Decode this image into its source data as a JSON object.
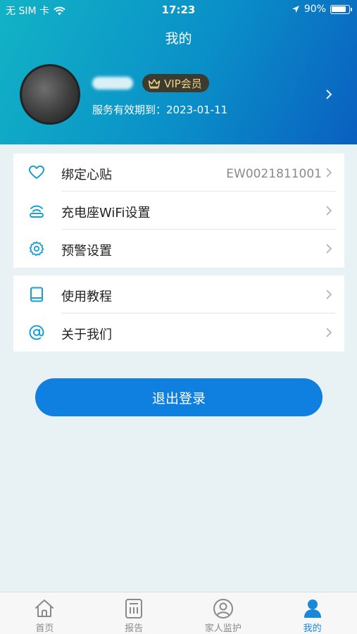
{
  "status_bar": {
    "carrier": "无 SIM 卡",
    "time": "17:23",
    "battery": "90%",
    "battery_level": 0.9
  },
  "header": {
    "title": "我的",
    "vip_label": "VIP会员",
    "expiry": "服务有效期到：2023-01-11"
  },
  "menu_group1": [
    {
      "label": "绑定心贴",
      "value": "EW0021811001",
      "icon": "heart-icon"
    },
    {
      "label": "充电座WiFi设置",
      "value": "",
      "icon": "wifi-charger-icon"
    },
    {
      "label": "预警设置",
      "value": "",
      "icon": "gear-icon"
    }
  ],
  "menu_group2": [
    {
      "label": "使用教程",
      "value": "",
      "icon": "book-icon"
    },
    {
      "label": "关于我们",
      "value": "",
      "icon": "at-icon"
    }
  ],
  "logout_label": "退出登录",
  "tabs": [
    {
      "label": "首页",
      "icon": "home-icon",
      "active": false
    },
    {
      "label": "报告",
      "icon": "report-icon",
      "active": false
    },
    {
      "label": "家人监护",
      "icon": "family-icon",
      "active": false
    },
    {
      "label": "我的",
      "icon": "profile-icon",
      "active": true
    }
  ],
  "colors": {
    "header_start": "#12b3c6",
    "header_end": "#0a5fc0",
    "accent": "#1080e0",
    "icon": "#1a9fd2",
    "vip_gold": "#f2d48c"
  }
}
